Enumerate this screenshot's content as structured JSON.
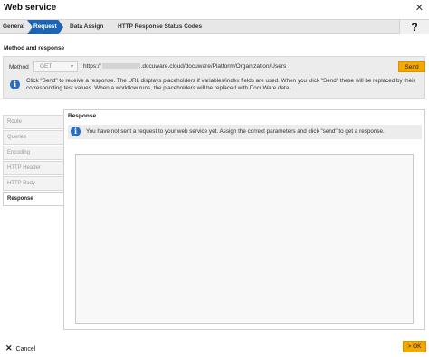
{
  "window": {
    "title": "Web service"
  },
  "tabs": [
    {
      "label": "General"
    },
    {
      "label": "Request"
    },
    {
      "label": "Data Assign"
    },
    {
      "label": "HTTP Response Status Codes"
    }
  ],
  "help_label": "?",
  "method_section": {
    "title": "Method and response",
    "method_label": "Method",
    "method_value": "GET",
    "url_prefix": "https://",
    "url_suffix": ".docuware.cloud/docuware/Platform/Organization/Users",
    "send_label": "Send",
    "info": "Click \"Send\" to receive a response. The URL displays placeholders if variables/index fields are used. When you click \"Send\" these will be replaced by their corresponding test values. When a workflow runs, the placeholders will be replaced with DocuWare data."
  },
  "sidenav": {
    "items": [
      {
        "label": "Route"
      },
      {
        "label": "Queries"
      },
      {
        "label": "Encoding"
      },
      {
        "label": "HTTP Header"
      },
      {
        "label": "HTTP Body"
      },
      {
        "label": "Response"
      }
    ]
  },
  "response": {
    "title": "Response",
    "info": "You have not sent a request to your web service yet. Assign the correct parameters and click \"send\" to get a response."
  },
  "footer": {
    "cancel_label": "Cancel",
    "ok_label": "> OK"
  },
  "colors": {
    "accent": "#1e64b4",
    "button": "#f5a800"
  }
}
